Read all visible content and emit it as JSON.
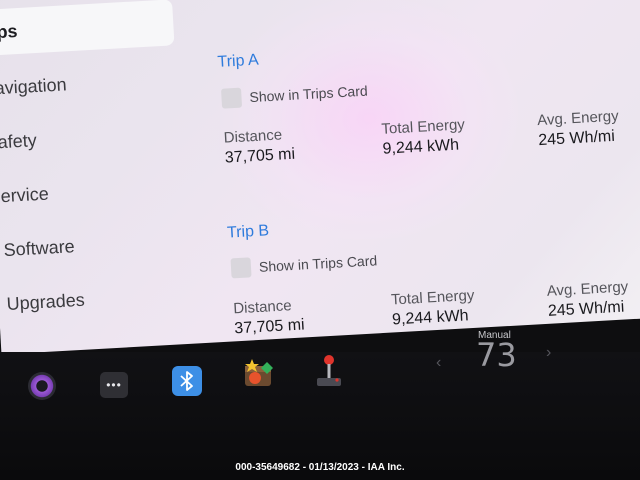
{
  "menu": {
    "items": [
      {
        "label": "ips"
      },
      {
        "label": "avigation"
      },
      {
        "label": "afety"
      },
      {
        "label": "ervice"
      },
      {
        "label": "Software"
      },
      {
        "label": "Upgrades"
      }
    ]
  },
  "trips": [
    {
      "title": "Trip A",
      "show_label": "Show in Trips Card",
      "distance_label": "Distance",
      "distance_value": "37,705 mi",
      "energy_label": "Total Energy",
      "energy_value": "9,244 kWh",
      "avg_label": "Avg. Energy",
      "avg_value": "245 Wh/mi"
    },
    {
      "title": "Trip B",
      "show_label": "Show in Trips Card",
      "distance_label": "Distance",
      "distance_value": "37,705 mi",
      "energy_label": "Total Energy",
      "energy_value": "9,244 kWh",
      "avg_label": "Avg. Energy",
      "avg_value": "245 Wh/mi"
    }
  ],
  "dock": {
    "icons": [
      "camera-icon",
      "more-icon",
      "bluetooth-icon",
      "toybox-icon",
      "arcade-joystick-icon"
    ],
    "more_glyph": "•••",
    "bluetooth_glyph": "ᛒ",
    "chevron_left": "‹",
    "chevron_right": "›",
    "climate_mode": "Manual",
    "temperature": "73"
  },
  "watermark": "000-35649682 - 01/13/2023 - IAA Inc.",
  "colors": {
    "accent": "#2e7bdc",
    "bluetooth": "#3d8fe6"
  }
}
